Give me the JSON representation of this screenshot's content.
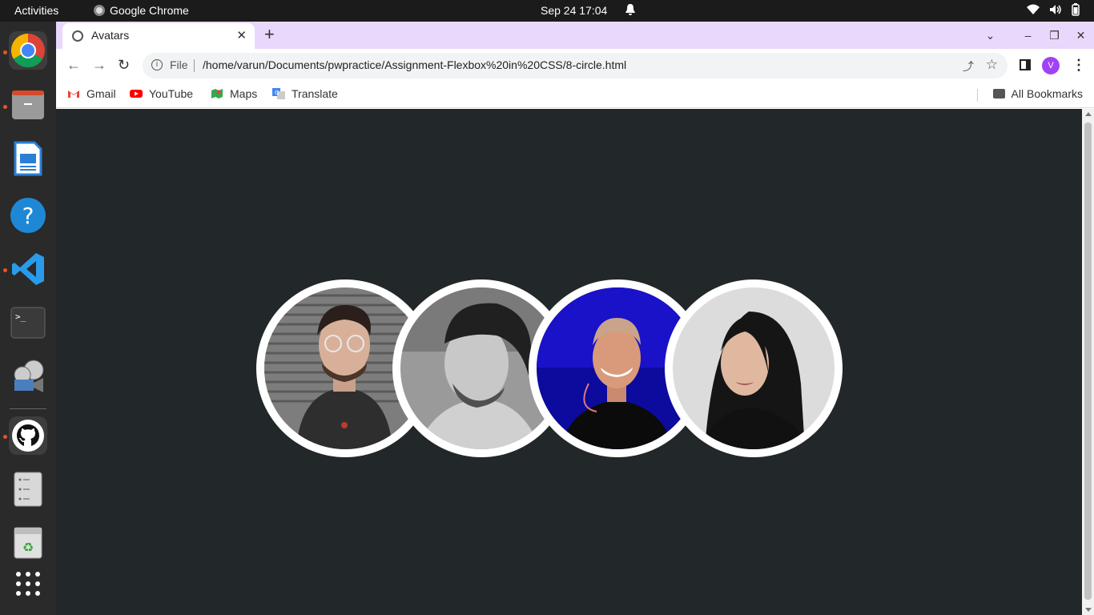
{
  "topbar": {
    "activities": "Activities",
    "app_name": "Google Chrome",
    "clock": "Sep 24  17:04"
  },
  "dock": {
    "items": [
      "chrome-icon",
      "files-icon",
      "writer-icon",
      "help-icon",
      "vscode-icon",
      "terminal-icon",
      "video-icon",
      "github-icon",
      "text-editor-icon",
      "trash-icon",
      "app-grid-icon"
    ]
  },
  "browser": {
    "tab_title": "Avatars",
    "omnibox": {
      "scheme_label": "File",
      "url": "/home/varun/Documents/pwpractice/Assignment-Flexbox%20in%20CSS/8-circle.html"
    },
    "profile_initial": "V",
    "bookmarks": [
      "Gmail",
      "YouTube",
      "Maps",
      "Translate"
    ],
    "all_bookmarks": "All Bookmarks"
  },
  "page": {
    "background": "#222729",
    "avatars": [
      {
        "name": "avatar-1",
        "tone": "grey-portrait"
      },
      {
        "name": "avatar-2",
        "tone": "bw-portrait"
      },
      {
        "name": "avatar-3",
        "tone": "blue-stage"
      },
      {
        "name": "avatar-4",
        "tone": "light-portrait"
      }
    ]
  },
  "colors": {
    "tab_strip": "#e9d8fb",
    "accent": "#a142f4",
    "ring": "#ffffff"
  }
}
